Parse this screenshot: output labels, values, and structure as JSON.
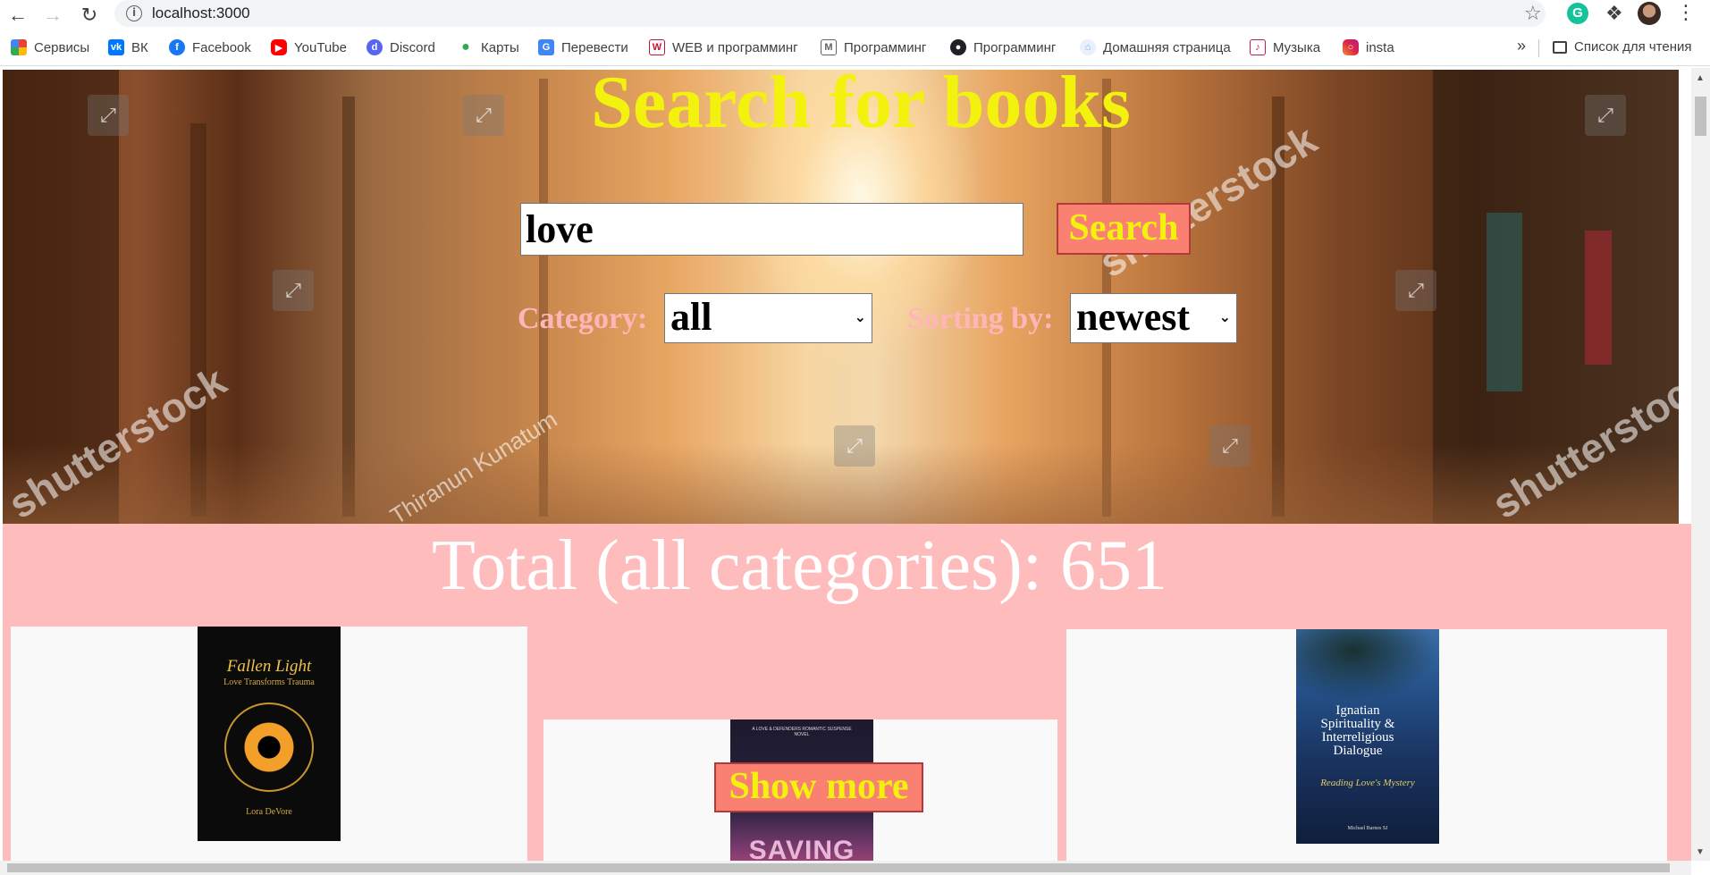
{
  "browser": {
    "url": "localhost:3000",
    "bookmarks": [
      {
        "label": "Сервисы",
        "icon": "apps-grid-icon",
        "color": "#ea4335"
      },
      {
        "label": "ВК",
        "icon": "vk-icon",
        "color": "#0077ff"
      },
      {
        "label": "Facebook",
        "icon": "facebook-icon",
        "color": "#1877f2"
      },
      {
        "label": "YouTube",
        "icon": "youtube-icon",
        "color": "#ff0000"
      },
      {
        "label": "Discord",
        "icon": "discord-icon",
        "color": "#5865f2"
      },
      {
        "label": "Карты",
        "icon": "maps-pin-icon",
        "color": "#34a853"
      },
      {
        "label": "Перевести",
        "icon": "translate-icon",
        "color": "#4285f4"
      },
      {
        "label": "WEB и программинг",
        "icon": "wm-icon",
        "color": "#c4122f"
      },
      {
        "label": "Программинг",
        "icon": "gmail-icon",
        "color": "#5f6368"
      },
      {
        "label": "Программинг",
        "icon": "globe-icon",
        "color": "#202124"
      },
      {
        "label": "Домашняя страница",
        "icon": "home-page-icon",
        "color": "#6fa8dc"
      },
      {
        "label": "Музыка",
        "icon": "music-icon",
        "color": "#c2185b"
      },
      {
        "label": "insta",
        "icon": "instagram-icon",
        "color": "#d6249f"
      }
    ],
    "more_label": "»",
    "reading_list_label": "Список для чтения"
  },
  "page": {
    "title": "Search for books",
    "search_value": "love",
    "search_button": "Search",
    "category_label": "Category:",
    "category_value": "all",
    "sorting_label": "Sorting by:",
    "sorting_value": "newest",
    "total_text": "Total (all categories): 651",
    "show_more": "Show more",
    "watermarks": [
      "shutterstock",
      "Thiranun Kunatum"
    ],
    "books": [
      {
        "cover_title": "Fallen Light",
        "cover_subtitle": "Love Transforms Trauma",
        "cover_author": "Lora DeVore"
      },
      {
        "cover_top": "A LOVE & DEFENDERS ROMANTIC SUSPENSE NOVEL",
        "cover_title": "SAVING"
      },
      {
        "cover_title": "Ignatian Spirituality & Interreligious Dialogue",
        "cover_subtitle": "Reading Love's Mystery",
        "cover_author": "Michael Barnes SJ"
      }
    ]
  },
  "colors": {
    "title": "#f2f20e",
    "button_bg": "#fa8072",
    "results_bg": "#ffbcbc",
    "label": "#ffb6b9"
  }
}
